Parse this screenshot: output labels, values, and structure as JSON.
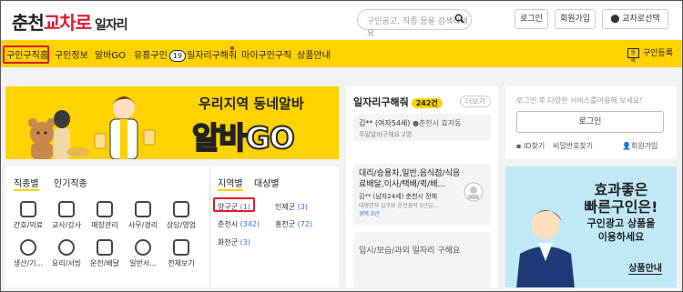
{
  "header": {
    "logo": {
      "part1": "춘천",
      "part2": "교차로",
      "part3": "일자리"
    },
    "search_placeholder": "구인공고, 직종 등을 검색하세요",
    "login": "로그인",
    "signup": "회원가입",
    "location": "교차로선택"
  },
  "nav": {
    "items": [
      {
        "label": "구인구직홈"
      },
      {
        "label": "구인정보"
      },
      {
        "label": "알바GO"
      },
      {
        "label": "유흥구인",
        "badge": "19"
      },
      {
        "label": "일자리구해줘"
      },
      {
        "label": "마이구인구직"
      },
      {
        "label": "상품안내"
      }
    ],
    "register": "구인등록",
    "register_icon_text": "등록"
  },
  "banner": {
    "line1": "우리지역 동네알바",
    "line2": "알바GO"
  },
  "category": {
    "tab_job": "직종별",
    "tab_popular": "인기직종",
    "jobs": [
      "간호/의료",
      "교사/강사",
      "매장관리",
      "사무/경리",
      "상담/영업",
      "생산/기...",
      "요리/서빙",
      "운전/배달",
      "일반서...",
      "전체보기"
    ],
    "tab_region": "지역별",
    "tab_target": "대상별",
    "regions": [
      {
        "name": "양구군",
        "count": "(1)"
      },
      {
        "name": "인제군",
        "count": "(3)"
      },
      {
        "name": "춘천시",
        "count": "(342)"
      },
      {
        "name": "홍천군",
        "count": "(72)"
      },
      {
        "name": "화천군",
        "count": "(3)"
      }
    ]
  },
  "seeking": {
    "title": "일자리구해줘",
    "count": "242건",
    "more": "더보기",
    "cards": [
      {
        "name": "김** (여자54세)",
        "loc": "춘천시 효자동",
        "desc": "주말알바구해요 2명"
      },
      {
        "title": "대리/승용차,일반,음식점/식음료배달,이사/택배/퀵/배...",
        "name": "김** (남자24세)",
        "loc": "춘천시 전체",
        "desc": "대형면허 있구요 운전경력 5년입...",
        "exp": "경력 5년"
      },
      {
        "title": "입시/보습/과외 일자리 구해요"
      }
    ]
  },
  "login_box": {
    "note": "로그인 후 다양한 서비스를이용해 보세요!",
    "button": "로그인",
    "find_id": "ID찾기",
    "find_pw": "비밀번호찾기",
    "join": "회원가입"
  },
  "promo": {
    "l1": "효과좋은",
    "l2": "빠른구인은!",
    "l3": "구인광고 상품을",
    "l4": "이용하세요",
    "btn": "상품안내"
  }
}
